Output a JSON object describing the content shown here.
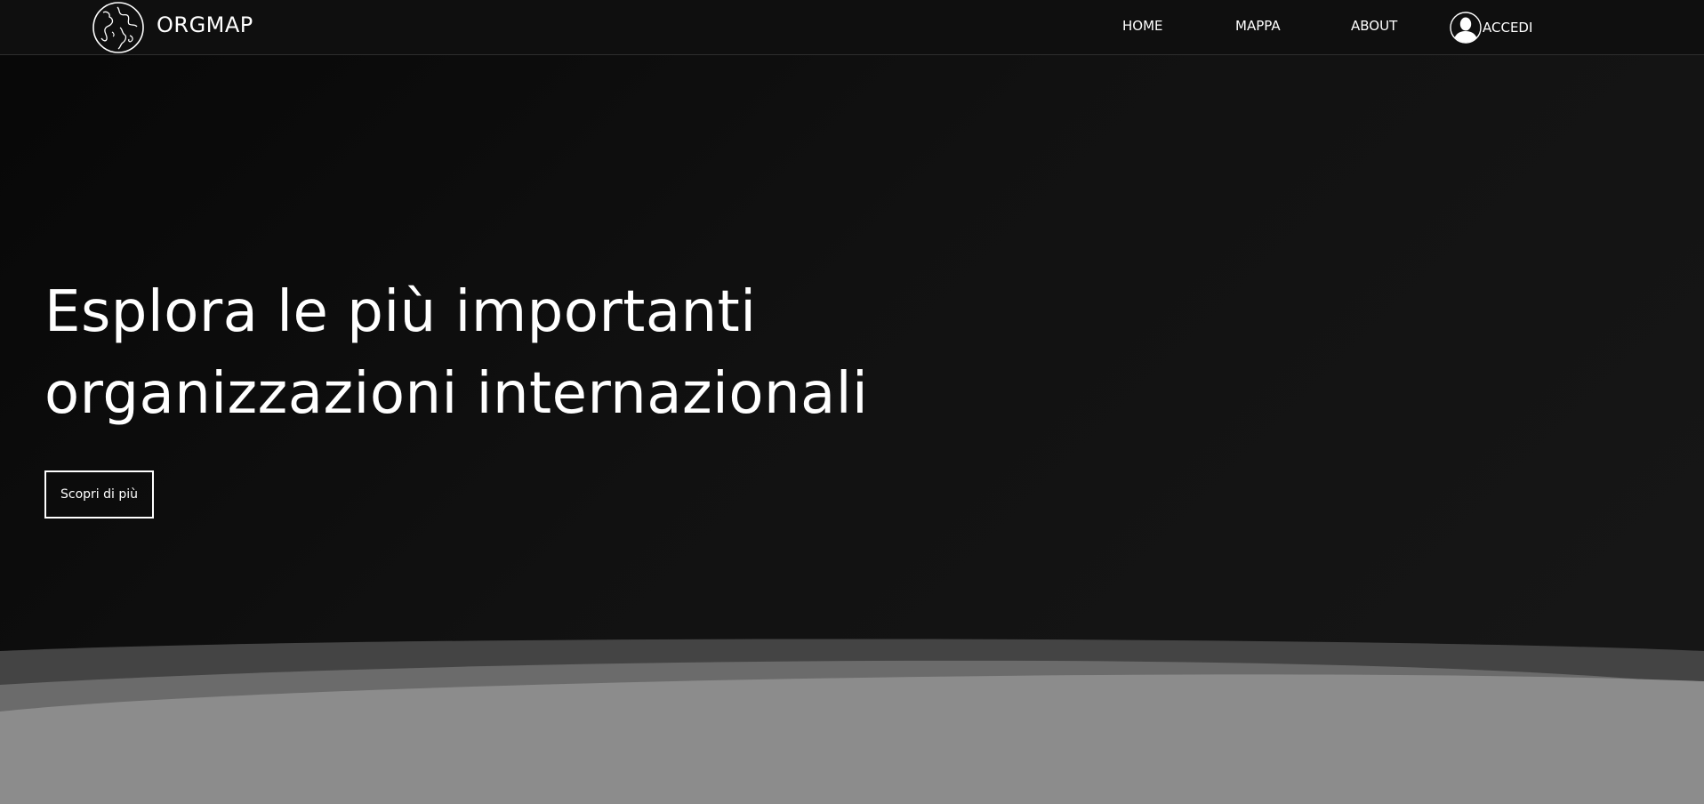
{
  "brand": {
    "name": "ORGMAP",
    "logo_icon": "globe-icon"
  },
  "nav": {
    "items": [
      {
        "label": "HOME"
      },
      {
        "label": "MAPPA"
      },
      {
        "label": "ABOUT"
      }
    ],
    "login": {
      "label": "ACCEDI",
      "icon": "user-avatar-icon"
    }
  },
  "hero": {
    "title_line1": "Esplora le più importanti",
    "title_line2": "organizzazioni internazionali",
    "cta_label": "Scopri di più"
  },
  "colors": {
    "background": "#0b0b0b",
    "navbar": "#0f0f0f",
    "text": "#ffffff",
    "wave_dark": "#444444",
    "wave_mid": "#6b6b6b",
    "wave_light": "#8c8c8c"
  }
}
